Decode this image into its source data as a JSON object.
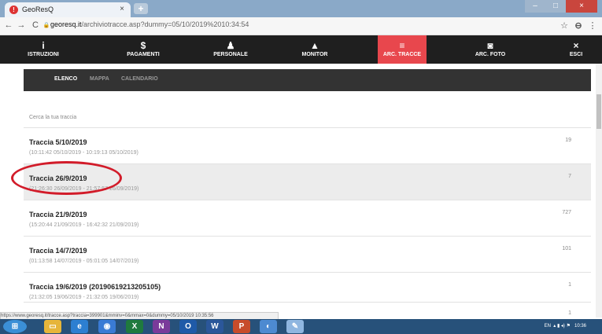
{
  "browser": {
    "tab_title": "GeoResQ",
    "tab_close": "×",
    "new_tab": "+",
    "win_minimize": "–",
    "win_maximize": "□",
    "win_close": "×",
    "back": "←",
    "forward": "→",
    "reload": "C",
    "lock": "🔒",
    "url_domain": "georesq.it",
    "url_path": "/archiviotracce.asp?dummy=05/10/2019%2010:34:54",
    "star": "☆",
    "menu": "⋮",
    "status_url": "https://www.georesq.it/tracce.asp?traccia=399901&mminv=0&mmax=0&dummy=05/10/2019 10:35:56"
  },
  "app_nav": [
    {
      "icon": "i",
      "label": "ISTRUZIONI"
    },
    {
      "icon": "$",
      "label": "PAGAMENTI"
    },
    {
      "icon": "♟",
      "label": "PERSONALE"
    },
    {
      "icon": "▲",
      "label": "MONITOR"
    },
    {
      "icon": "≡",
      "label": "ARC. TRACCE"
    },
    {
      "icon": "◙",
      "label": "ARC. FOTO"
    },
    {
      "icon": "×",
      "label": "ESCI"
    }
  ],
  "sub_nav": [
    "ELENCO",
    "MAPPA",
    "CALENDARIO"
  ],
  "search_label": "Cerca la tua traccia",
  "tracks": [
    {
      "title": "Traccia 5/10/2019",
      "range": "(10:11:42 05/10/2019 - 10:19:13 05/10/2019)",
      "count": "19"
    },
    {
      "title": "Traccia 26/9/2019",
      "range": "(21:26:30 26/09/2019 - 21:57:57 26/09/2019)",
      "count": "7"
    },
    {
      "title": "Traccia 21/9/2019",
      "range": "(15:20:44 21/09/2019 - 16:42:32 21/09/2019)",
      "count": "727"
    },
    {
      "title": "Traccia 14/7/2019",
      "range": "(01:13:58 14/07/2019 - 05:01:05 14/07/2019)",
      "count": "101"
    },
    {
      "title": "Traccia 19/6/2019 (20190619213205105)",
      "range": "(21:32:05 19/06/2019 - 21:32:05 19/06/2019)",
      "count": "1"
    },
    {
      "title": "",
      "range": "",
      "count": "1"
    }
  ],
  "tray_time": "10:36",
  "tray_lang": "EN",
  "colors": {
    "accent": "#e8474d",
    "nav_bg": "#1f1f1f",
    "subnav_bg": "#333333",
    "highlight_circle": "#d21c2a"
  }
}
